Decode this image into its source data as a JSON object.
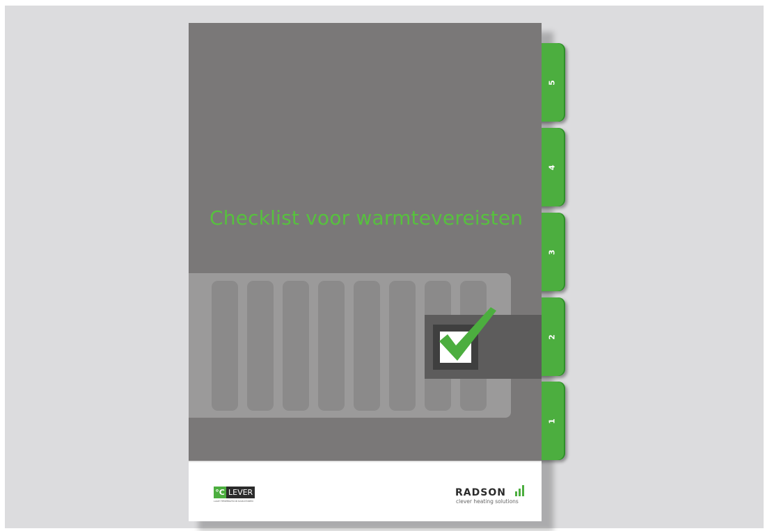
{
  "cover": {
    "title": "Checklist voor warmtevereisten"
  },
  "tabs": [
    "5",
    "4",
    "3",
    "2",
    "1"
  ],
  "logos": {
    "clever": {
      "degree": "°C",
      "word": "LEVER",
      "tagline": "LAGE TEMPERATUUR RADIATOREN"
    },
    "radson": {
      "name": "RADSON",
      "tagline": "clever heating solutions"
    }
  },
  "colors": {
    "accent_green": "#4cae3f",
    "title_green": "#57c13e",
    "cover_gray": "#7a7878",
    "background": "#dcdcde"
  },
  "icons": [
    "checkmark-icon",
    "radiator-illustration",
    "signal-bars-icon"
  ]
}
